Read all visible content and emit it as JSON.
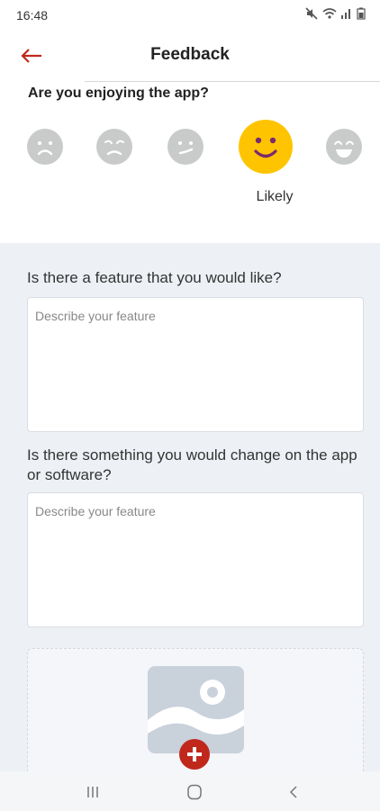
{
  "status_bar": {
    "time": "16:48",
    "icons": [
      "mute-icon",
      "wifi-icon",
      "signal-icon",
      "battery-icon"
    ]
  },
  "header": {
    "title": "Feedback",
    "back_icon": "back-arrow-icon",
    "accent_color": "#c0281c"
  },
  "rating": {
    "question": "Are you enjoying the app?",
    "options": [
      "very-sad",
      "sad",
      "neutral",
      "likely",
      "very-happy"
    ],
    "selected_index": 3,
    "selected_label": "Likely",
    "selected_color": "#ffc400",
    "unselected_color": "#c9cbcb"
  },
  "form": {
    "feature_question": "Is there a feature that you would like?",
    "feature_placeholder": "Describe your feature",
    "change_question": "Is there something you would change on the app or software?",
    "change_placeholder": "Describe your feature"
  },
  "upload": {
    "icon": "image-placeholder-icon",
    "add_icon": "add-photo-icon"
  },
  "nav_bar": {
    "buttons": [
      "recent-apps-icon",
      "home-icon",
      "back-icon"
    ]
  }
}
